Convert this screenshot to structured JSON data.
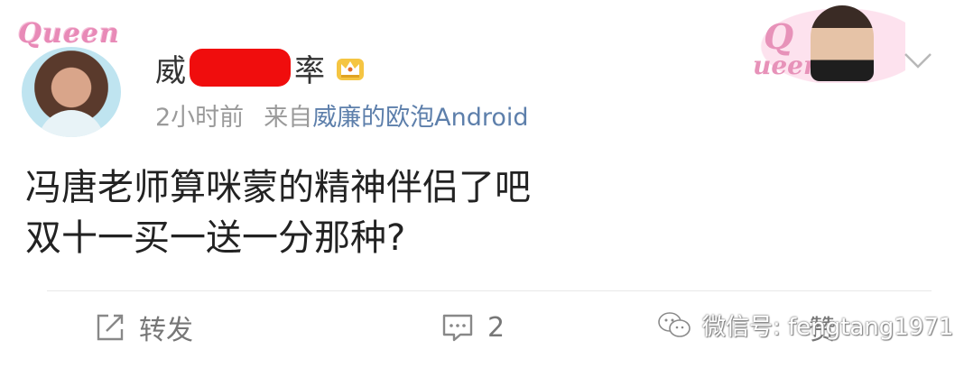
{
  "post": {
    "avatar_badge": "Queen",
    "username_prefix": "威",
    "username_suffix": "率",
    "time_ago": "2小时前",
    "source_prefix": "来自",
    "source_client": "威廉的欧泡Android",
    "body": "冯唐老师算咪蒙的精神伴侣了吧\n双十一买一送一分那种?"
  },
  "decoration": {
    "q_letter": "Q",
    "q_word": "ueen"
  },
  "actions": {
    "repost_label": "转发",
    "comment_count": "2",
    "like_label": "赞"
  },
  "watermark": {
    "text": "微信号: fengtang1971"
  },
  "icons": {
    "repost": "repost-icon",
    "comment": "comment-icon",
    "like": "like-icon",
    "vip": "crown-vip-icon",
    "chevron": "chevron-down-icon",
    "wechat": "wechat-icon"
  },
  "colors": {
    "redaction": "#f00d0d",
    "source_link": "#5d7fab",
    "meta_gray": "#9a9a9a",
    "accent_pink": "#e792b9"
  }
}
